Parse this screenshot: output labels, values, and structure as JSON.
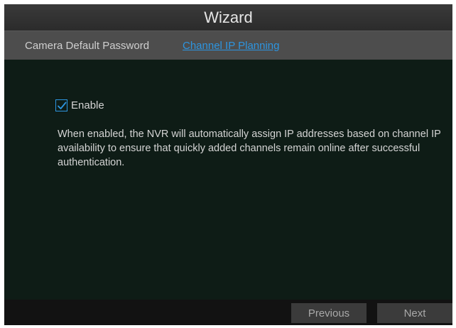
{
  "window": {
    "title": "Wizard"
  },
  "tabs": [
    {
      "label": "Camera Default Password",
      "active": false
    },
    {
      "label": "Channel IP Planning",
      "active": true
    }
  ],
  "settings": {
    "enable_label": "Enable",
    "enable_checked": true,
    "description": "When enabled, the NVR will automatically assign IP addresses based on channel IP availability to ensure that quickly added channels remain online after successful authentication."
  },
  "footer": {
    "previous_label": "Previous",
    "next_label": "Next"
  },
  "colors": {
    "accent": "#2d95e0",
    "content_bg": "#0e1c16",
    "tabbar_bg": "#4d4d4d",
    "button_bg": "#3b3b3b"
  },
  "icons": {
    "checkbox": "checkmark-icon"
  }
}
